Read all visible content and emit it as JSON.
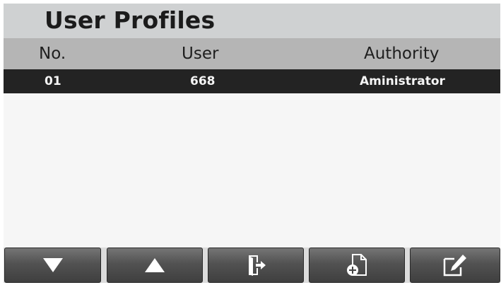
{
  "header": {
    "title": "User Profiles"
  },
  "table": {
    "columns": [
      "No.",
      "User",
      "Authority"
    ],
    "rows": [
      {
        "no": "01",
        "user": "668",
        "authority": "Aministrator",
        "selected": true
      }
    ]
  },
  "toolbar": {
    "buttons": [
      {
        "icon": "arrow-down-icon"
      },
      {
        "icon": "arrow-up-icon"
      },
      {
        "icon": "logout-door-icon"
      },
      {
        "icon": "add-document-icon"
      },
      {
        "icon": "edit-icon"
      }
    ]
  },
  "colors": {
    "title_bar": "#cfd1d2",
    "header_row": "#b5b5b5",
    "selected_row": "#232323",
    "button": "#555555"
  }
}
